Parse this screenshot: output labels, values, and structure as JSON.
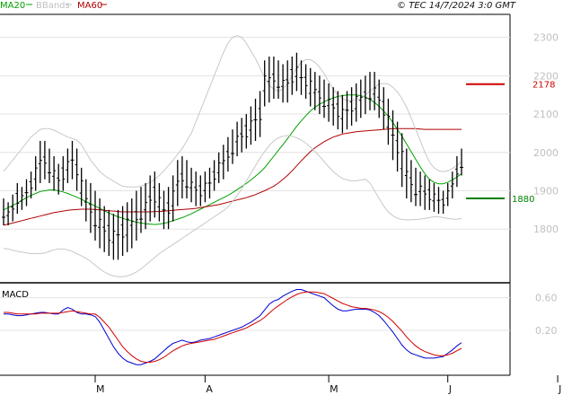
{
  "header": {
    "legend": [
      {
        "name": "MA20",
        "color": "#00a000"
      },
      {
        "name": "BBands",
        "color": "#c0c0c0"
      },
      {
        "name": "MA60",
        "color": "#b00000"
      }
    ],
    "copyright": "© TEC 14/7/2024 3:0 GMT"
  },
  "macd_label": "MACD",
  "chart_data": [
    {
      "type": "ohlc",
      "panel": "price",
      "ylim": [
        1660,
        2360
      ],
      "y_ticks": [
        "2300",
        "2200",
        "2100",
        "2000",
        "1900",
        "1800"
      ],
      "x_ticks": [
        "M",
        "A",
        "M",
        "J",
        "J"
      ],
      "x_tick_index": [
        20,
        44,
        71,
        97,
        121
      ],
      "levels": [
        {
          "label": "2178",
          "value": 2178,
          "color": "#d00000"
        },
        {
          "label": "1880",
          "value": 1880,
          "color": "#008000"
        }
      ],
      "series": [
        {
          "name": "MA20",
          "color": "#00a000",
          "values": [
            1850,
            1856,
            1862,
            1868,
            1875,
            1882,
            1888,
            1893,
            1898,
            1900,
            1902,
            1902,
            1900,
            1897,
            1893,
            1888,
            1883,
            1878,
            1872,
            1866,
            1860,
            1854,
            1848,
            1842,
            1837,
            1832,
            1828,
            1824,
            1821,
            1818,
            1816,
            1814,
            1813,
            1812,
            1813,
            1815,
            1818,
            1822,
            1826,
            1830,
            1835,
            1840,
            1846,
            1852,
            1858,
            1864,
            1870,
            1876,
            1882,
            1888,
            1895,
            1903,
            1911,
            1919,
            1928,
            1938,
            1948,
            1960,
            1975,
            1990,
            2005,
            2020,
            2036,
            2052,
            2068,
            2082,
            2096,
            2108,
            2118,
            2126,
            2132,
            2138,
            2142,
            2146,
            2148,
            2150,
            2150,
            2150,
            2148,
            2144,
            2138,
            2130,
            2120,
            2108,
            2094,
            2078,
            2060,
            2042,
            2022,
            2002,
            1982,
            1962,
            1944,
            1930,
            1922,
            1918,
            1918,
            1922,
            1928,
            1936,
            1944
          ]
        },
        {
          "name": "MA60",
          "color": "#b00000",
          "values": [
            1810,
            1813,
            1816,
            1819,
            1822,
            1825,
            1828,
            1831,
            1834,
            1837,
            1840,
            1843,
            1845,
            1847,
            1849,
            1850,
            1851,
            1852,
            1852,
            1852,
            1851,
            1850,
            1849,
            1848,
            1847,
            1846,
            1845,
            1845,
            1845,
            1845,
            1845,
            1845,
            1845,
            1846,
            1846,
            1847,
            1848,
            1849,
            1850,
            1851,
            1852,
            1853,
            1854,
            1856,
            1858,
            1860,
            1862,
            1864,
            1867,
            1870,
            1873,
            1876,
            1879,
            1882,
            1886,
            1890,
            1895,
            1900,
            1906,
            1912,
            1920,
            1930,
            1940,
            1952,
            1965,
            1978,
            1990,
            2002,
            2012,
            2020,
            2028,
            2034,
            2040,
            2044,
            2048,
            2050,
            2052,
            2054,
            2055,
            2056,
            2057,
            2058,
            2059,
            2060,
            2061,
            2062,
            2062,
            2062,
            2062,
            2062,
            2062,
            2061,
            2060,
            2060,
            2060,
            2060,
            2060,
            2060,
            2060,
            2060,
            2060
          ]
        },
        {
          "name": "BB Upper",
          "color": "#c8c8c8",
          "values": [
            1950,
            1965,
            1980,
            1995,
            2010,
            2025,
            2040,
            2050,
            2060,
            2062,
            2062,
            2058,
            2052,
            2046,
            2040,
            2036,
            2032,
            2020,
            2000,
            1980,
            1965,
            1950,
            1940,
            1932,
            1925,
            1918,
            1912,
            1910,
            1910,
            1910,
            1912,
            1916,
            1922,
            1930,
            1940,
            1952,
            1966,
            1980,
            1995,
            2010,
            2030,
            2050,
            2080,
            2110,
            2140,
            2170,
            2200,
            2230,
            2260,
            2285,
            2300,
            2305,
            2300,
            2285,
            2265,
            2245,
            2220,
            2195,
            2175,
            2165,
            2160,
            2165,
            2180,
            2200,
            2220,
            2235,
            2242,
            2242,
            2235,
            2222,
            2205,
            2185,
            2165,
            2150,
            2140,
            2135,
            2135,
            2138,
            2142,
            2150,
            2160,
            2170,
            2178,
            2180,
            2178,
            2170,
            2158,
            2140,
            2118,
            2090,
            2060,
            2030,
            2000,
            1975,
            1960,
            1952,
            1950,
            1952,
            1958,
            1966,
            1976
          ]
        },
        {
          "name": "BB Lower",
          "color": "#c8c8c8",
          "values": [
            1750,
            1748,
            1745,
            1742,
            1740,
            1738,
            1736,
            1736,
            1736,
            1738,
            1742,
            1746,
            1748,
            1748,
            1746,
            1742,
            1736,
            1730,
            1724,
            1716,
            1706,
            1696,
            1688,
            1682,
            1678,
            1676,
            1676,
            1678,
            1682,
            1688,
            1696,
            1706,
            1716,
            1726,
            1736,
            1744,
            1752,
            1760,
            1768,
            1776,
            1784,
            1792,
            1800,
            1808,
            1816,
            1824,
            1832,
            1840,
            1848,
            1858,
            1872,
            1888,
            1905,
            1925,
            1945,
            1965,
            1985,
            2002,
            2018,
            2030,
            2038,
            2042,
            2044,
            2042,
            2038,
            2032,
            2024,
            2014,
            2002,
            1990,
            1976,
            1962,
            1950,
            1940,
            1932,
            1928,
            1926,
            1926,
            1928,
            1930,
            1920,
            1900,
            1880,
            1860,
            1845,
            1835,
            1828,
            1825,
            1824,
            1824,
            1825,
            1826,
            1828,
            1830,
            1832,
            1832,
            1830,
            1828,
            1826,
            1826,
            1828
          ]
        },
        {
          "name": "Price",
          "type": "ohlc",
          "color": "#000000",
          "high": [
            1880,
            1870,
            1890,
            1920,
            1910,
            1930,
            1950,
            1990,
            2030,
            2030,
            2010,
            1990,
            1970,
            1990,
            2010,
            2030,
            2010,
            1960,
            1930,
            1920,
            1900,
            1880,
            1860,
            1850,
            1840,
            1850,
            1860,
            1870,
            1880,
            1900,
            1910,
            1920,
            1940,
            1950,
            1920,
            1900,
            1910,
            1940,
            1980,
            1990,
            1980,
            1960,
            1950,
            1940,
            1950,
            1960,
            1980,
            2000,
            2020,
            2040,
            2060,
            2080,
            2090,
            2100,
            2120,
            2140,
            2160,
            2240,
            2250,
            2250,
            2240,
            2230,
            2240,
            2250,
            2260,
            2240,
            2230,
            2220,
            2210,
            2200,
            2190,
            2180,
            2170,
            2160,
            2150,
            2160,
            2170,
            2180,
            2190,
            2200,
            2210,
            2210,
            2190,
            2170,
            2140,
            2110,
            2080,
            2050,
            2010,
            1980,
            1960,
            1950,
            1940,
            1930,
            1920,
            1910,
            1900,
            1920,
            1950,
            1990,
            2010
          ]
        },
        {
          "name": "Price low",
          "color": "#000000",
          "low": [
            1810,
            1810,
            1820,
            1840,
            1850,
            1860,
            1880,
            1900,
            1920,
            1930,
            1920,
            1900,
            1890,
            1900,
            1920,
            1930,
            1900,
            1860,
            1820,
            1790,
            1770,
            1750,
            1740,
            1730,
            1720,
            1720,
            1730,
            1740,
            1750,
            1770,
            1790,
            1800,
            1820,
            1830,
            1820,
            1800,
            1800,
            1820,
            1860,
            1880,
            1880,
            1870,
            1860,
            1860,
            1870,
            1880,
            1900,
            1920,
            1930,
            1950,
            1970,
            1990,
            2000,
            2010,
            2020,
            2030,
            2040,
            2120,
            2130,
            2140,
            2140,
            2130,
            2130,
            2150,
            2160,
            2150,
            2140,
            2120,
            2110,
            2100,
            2090,
            2080,
            2070,
            2060,
            2050,
            2060,
            2070,
            2080,
            2090,
            2100,
            2110,
            2110,
            2090,
            2060,
            2020,
            1980,
            1950,
            1910,
            1880,
            1870,
            1860,
            1860,
            1850,
            1850,
            1845,
            1840,
            1840,
            1860,
            1880,
            1910,
            1940
          ]
        }
      ],
      "grid": true
    },
    {
      "type": "line",
      "panel": "macd",
      "ylim": [
        -0.35,
        0.75
      ],
      "y_ticks": [
        "0.60",
        "0.20"
      ],
      "series": [
        {
          "name": "MACD",
          "color": "#0000d0",
          "values": [
            0.4,
            0.4,
            0.39,
            0.38,
            0.38,
            0.39,
            0.4,
            0.41,
            0.42,
            0.42,
            0.41,
            0.4,
            0.4,
            0.45,
            0.48,
            0.46,
            0.42,
            0.4,
            0.4,
            0.39,
            0.37,
            0.3,
            0.2,
            0.1,
            0.0,
            -0.08,
            -0.14,
            -0.18,
            -0.2,
            -0.22,
            -0.22,
            -0.2,
            -0.18,
            -0.15,
            -0.1,
            -0.05,
            0.0,
            0.04,
            0.06,
            0.08,
            0.06,
            0.05,
            0.06,
            0.08,
            0.09,
            0.1,
            0.12,
            0.14,
            0.16,
            0.18,
            0.2,
            0.22,
            0.24,
            0.27,
            0.3,
            0.34,
            0.38,
            0.45,
            0.52,
            0.56,
            0.58,
            0.62,
            0.65,
            0.68,
            0.7,
            0.7,
            0.68,
            0.66,
            0.64,
            0.62,
            0.6,
            0.55,
            0.5,
            0.46,
            0.44,
            0.44,
            0.45,
            0.46,
            0.46,
            0.46,
            0.45,
            0.42,
            0.38,
            0.32,
            0.25,
            0.18,
            0.1,
            0.02,
            -0.04,
            -0.08,
            -0.1,
            -0.12,
            -0.14,
            -0.14,
            -0.14,
            -0.13,
            -0.12,
            -0.08,
            -0.04,
            0.01,
            0.05
          ]
        },
        {
          "name": "Signal",
          "color": "#d00000",
          "values": [
            0.42,
            0.42,
            0.41,
            0.4,
            0.4,
            0.4,
            0.4,
            0.4,
            0.41,
            0.41,
            0.41,
            0.41,
            0.41,
            0.42,
            0.43,
            0.44,
            0.43,
            0.42,
            0.41,
            0.4,
            0.4,
            0.36,
            0.3,
            0.24,
            0.16,
            0.08,
            0.0,
            -0.06,
            -0.11,
            -0.15,
            -0.18,
            -0.19,
            -0.19,
            -0.18,
            -0.16,
            -0.13,
            -0.09,
            -0.05,
            -0.02,
            0.01,
            0.03,
            0.04,
            0.05,
            0.06,
            0.07,
            0.08,
            0.09,
            0.11,
            0.13,
            0.15,
            0.17,
            0.19,
            0.21,
            0.23,
            0.26,
            0.29,
            0.32,
            0.36,
            0.41,
            0.46,
            0.5,
            0.54,
            0.58,
            0.61,
            0.64,
            0.66,
            0.67,
            0.67,
            0.67,
            0.66,
            0.65,
            0.62,
            0.59,
            0.56,
            0.53,
            0.51,
            0.49,
            0.48,
            0.47,
            0.47,
            0.46,
            0.45,
            0.43,
            0.4,
            0.36,
            0.31,
            0.25,
            0.19,
            0.12,
            0.06,
            0.01,
            -0.03,
            -0.06,
            -0.08,
            -0.1,
            -0.11,
            -0.11,
            -0.1,
            -0.08,
            -0.05,
            -0.02
          ]
        }
      ]
    }
  ]
}
